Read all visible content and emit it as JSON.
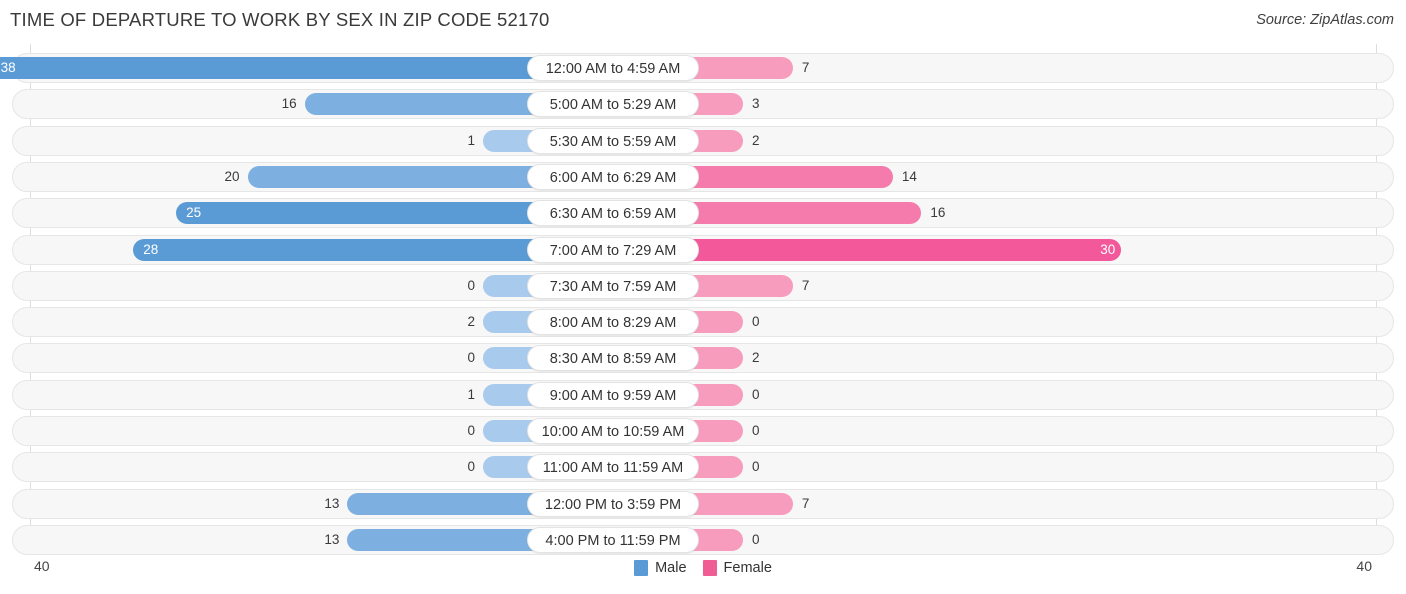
{
  "header": {
    "title": "TIME OF DEPARTURE TO WORK BY SEX IN ZIP CODE 52170",
    "source": "Source: ZipAtlas.com"
  },
  "legend": {
    "male_label": "Male",
    "female_label": "Female",
    "male_color": "#5b9bd5",
    "female_color": "#ee5e95"
  },
  "axis": {
    "left_end": "40",
    "right_end": "40"
  },
  "chart_data": {
    "type": "bar",
    "subtype": "diverging-bidirectional",
    "title": "TIME OF DEPARTURE TO WORK BY SEX IN ZIP CODE 52170",
    "xlabel": "",
    "ylabel": "",
    "xlim": [
      -40,
      40
    ],
    "axis_max": 40,
    "grid": true,
    "legend_position": "bottom-center",
    "categories": [
      "12:00 AM to 4:59 AM",
      "5:00 AM to 5:29 AM",
      "5:30 AM to 5:59 AM",
      "6:00 AM to 6:29 AM",
      "6:30 AM to 6:59 AM",
      "7:00 AM to 7:29 AM",
      "7:30 AM to 7:59 AM",
      "8:00 AM to 8:29 AM",
      "8:30 AM to 8:59 AM",
      "9:00 AM to 9:59 AM",
      "10:00 AM to 10:59 AM",
      "11:00 AM to 11:59 AM",
      "12:00 PM to 3:59 PM",
      "4:00 PM to 11:59 PM"
    ],
    "series": [
      {
        "name": "Male",
        "direction": "left",
        "color": "#5b9bd5",
        "values": [
          38,
          16,
          1,
          20,
          25,
          28,
          0,
          2,
          0,
          1,
          0,
          0,
          13,
          13
        ]
      },
      {
        "name": "Female",
        "direction": "right",
        "color": "#ee5e95",
        "values": [
          7,
          3,
          2,
          14,
          16,
          30,
          7,
          0,
          2,
          0,
          0,
          0,
          7,
          0
        ]
      }
    ]
  }
}
